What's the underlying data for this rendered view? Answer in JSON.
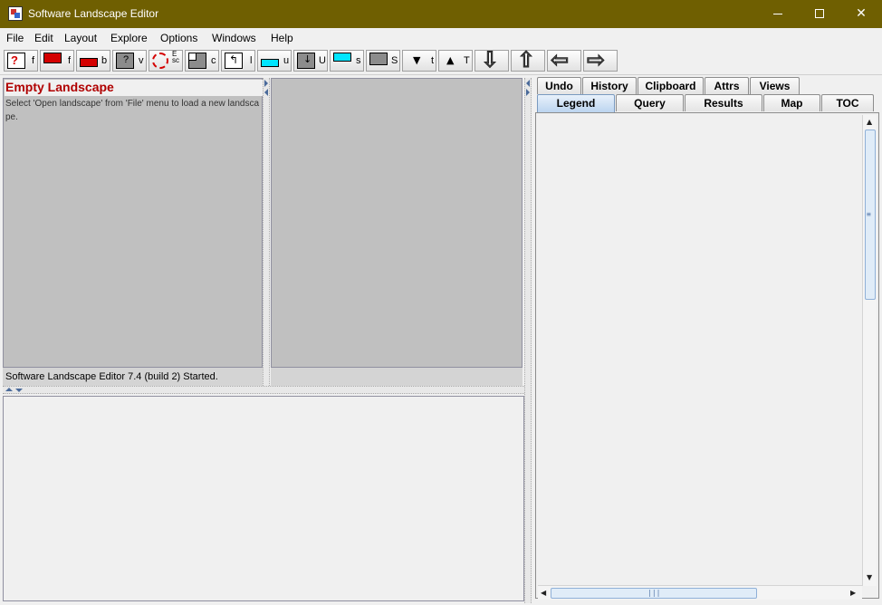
{
  "window": {
    "title": "Software Landscape Editor",
    "minimize_label": "",
    "maximize_label": "",
    "close_label": "✕"
  },
  "menu": [
    "File",
    "Edit",
    "Layout",
    "Explore",
    "Options",
    "Windows",
    "Help"
  ],
  "toolbar": {
    "letters": [
      "f",
      "f",
      "b",
      "v",
      "",
      "c",
      "l",
      "u",
      "U",
      "s",
      "S",
      "t",
      "T"
    ],
    "esc_label": "Esc",
    "arrow_down": "⇩",
    "arrow_up": "⇧",
    "arrow_left": "⇦",
    "arrow_right": "⇨"
  },
  "landscape": {
    "title": "Empty Landscape",
    "message": "Select 'Open landscape' from 'File' menu to load a new landscape."
  },
  "status": {
    "text": "Software Landscape Editor 7.4 (build 2) Started."
  },
  "tabs": {
    "row1": [
      "Undo",
      "History",
      "Clipboard",
      "Attrs",
      "Views"
    ],
    "row2": [
      "Legend",
      "Query",
      "Results",
      "Map",
      "TOC"
    ],
    "selected": "Legend"
  },
  "scroll": {
    "up": "▲",
    "down": "▼",
    "left": "◀",
    "right": "▶",
    "vgrip": "≡",
    "hgrip": "|||"
  },
  "icons": {
    "app": "app-icon",
    "minimize": "minimize-icon",
    "maximize": "maximize-icon",
    "close": "close-icon"
  }
}
